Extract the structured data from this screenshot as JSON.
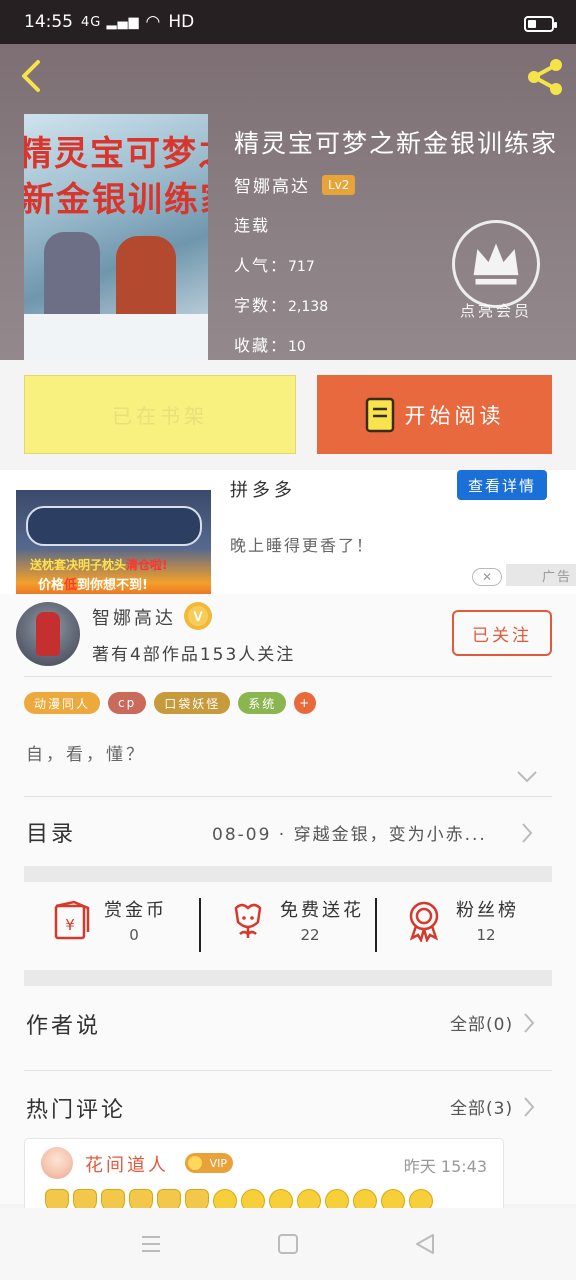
{
  "status_bar": {
    "time": "14:55",
    "signal": "4G",
    "network": "HD",
    "battery_icon": "battery-icon"
  },
  "header": {
    "back_icon": "back-arrow-icon",
    "share_icon": "share-icon"
  },
  "book": {
    "cover_text_line1": "精灵宝可梦之",
    "cover_text_line2": "新金银训练家",
    "title": "精灵宝可梦之新金银训练家",
    "author": "智娜高达",
    "level": "Lv2",
    "status": "连载",
    "popularity_label": "人气：",
    "popularity_value": "717",
    "words_label": "字数：",
    "words_value": "2,138",
    "favorites_label": "收藏：",
    "favorites_value": "10",
    "vip_icon": "crown-icon",
    "vip_label": "点亮会员"
  },
  "actions": {
    "shelf_label": "已在书架",
    "read_label": "开始阅读"
  },
  "ad": {
    "brand": "拼多多",
    "detail_button": "查看详情",
    "description": "晚上睡得更香了！",
    "image_text_line1a": "送枕套决明子枕头",
    "image_text_line1b": "清仓啦!",
    "image_text_line2a": "价格",
    "image_text_line2b": "低",
    "image_text_line2c": "到你想不到!",
    "close_symbol": "✕",
    "ad_label": "广告"
  },
  "author_profile": {
    "name": "智娜高达",
    "verified_symbol": "V",
    "stats": "著有4部作品153人关注",
    "follow_label": "已关注",
    "tags": [
      {
        "label": "动漫同人",
        "color": "#eea93d"
      },
      {
        "label": "cp",
        "color": "#c96a5a"
      },
      {
        "label": "口袋妖怪",
        "color": "#c79a3c"
      },
      {
        "label": "系统",
        "color": "#8bb64f"
      },
      {
        "label": "+",
        "color": "#e86a3a"
      }
    ],
    "intro": "自，看，懂？"
  },
  "toc": {
    "label": "目录",
    "latest_chapter": "08-09 · 穿越金银，变为小赤..."
  },
  "stats": [
    {
      "label": "赏金币",
      "value": "0",
      "icon": "reward-coin-icon"
    },
    {
      "label": "免费送花",
      "value": "22",
      "icon": "flower-icon"
    },
    {
      "label": "粉丝榜",
      "value": "12",
      "icon": "fan-ranking-icon"
    }
  ],
  "author_says": {
    "title": "作者说",
    "all_label": "全部(0)"
  },
  "hot_comments": {
    "title": "热门评论",
    "all_label": "全部(3)",
    "items": [
      {
        "name": "花间道人",
        "vip": "VIP",
        "time": "昨天 15:43"
      }
    ]
  },
  "navbar": {
    "menu_icon": "menu-icon",
    "home_icon": "home-square-icon",
    "back_icon": "nav-back-icon"
  },
  "colors": {
    "accent_orange": "#e9693e",
    "shelf_yellow": "#f8f17f",
    "ad_blue": "#1b6fd8"
  }
}
